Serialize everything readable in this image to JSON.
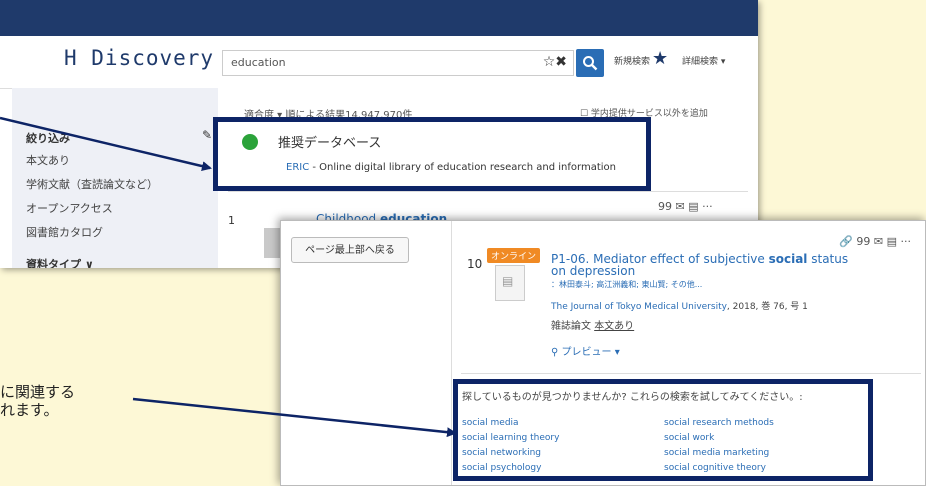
{
  "back_screen": {
    "logo": "H Discovery",
    "search": {
      "value": "education",
      "icons": "☆✖",
      "new_search": "新規検索",
      "advanced_search": "詳細検索 ▾"
    },
    "sidebar": {
      "refine_title": "絞り込み",
      "items": [
        "本文あり",
        "学術文献（査読論文など）",
        "オープンアクセス",
        "図書館カタログ"
      ],
      "type_title": "資料タイプ ∨"
    },
    "sort_line": "適合度 ▾ 順による結果14,947,970件",
    "add_external": "☐ 学内提供サービス以外を追加",
    "recommend": {
      "title": "推奨データベース",
      "link_name": "ERIC",
      "link_desc": " - Online digital library of education research and information"
    },
    "result1": {
      "number": "1",
      "title_prefix": "Childhood ",
      "title_bold": "education",
      "icons": "99 ✉ ▤ ···"
    }
  },
  "front_screen": {
    "back_to_top": "ページ最上部へ戻る",
    "result10": {
      "number": "10",
      "badge": "オンライン",
      "title_a": "P1-06. Mediator effect of subjective ",
      "title_bold": "social",
      "title_b": " status on depression",
      "authors": "：林田泰斗; 高江洲義和; 東山賢; その他...",
      "journal": "The Journal of Tokyo Medical University",
      "source_rest": ", 2018, 巻 76, 号 1",
      "type": "雑誌論文 ",
      "fulltext": "本文あり",
      "preview": "プレビュー ▾",
      "icons": "🔗 99 ✉ ▤ ···"
    },
    "suggestions": {
      "prompt": "探しているものが見つかりませんか? これらの検索を試してみてください。:",
      "left": [
        "social media",
        "social learning theory",
        "social networking",
        "social psychology"
      ],
      "right": [
        "social research methods",
        "social work",
        "social media marketing",
        "social cognitive theory"
      ]
    }
  },
  "caption": {
    "line1": "に関連する",
    "line2": "れます。"
  },
  "colors": {
    "highlight": "#0d2466",
    "topbar": "#1f3a6b",
    "link": "#2a6db5",
    "badge": "#f08a24",
    "background": "#fdf8d6"
  }
}
